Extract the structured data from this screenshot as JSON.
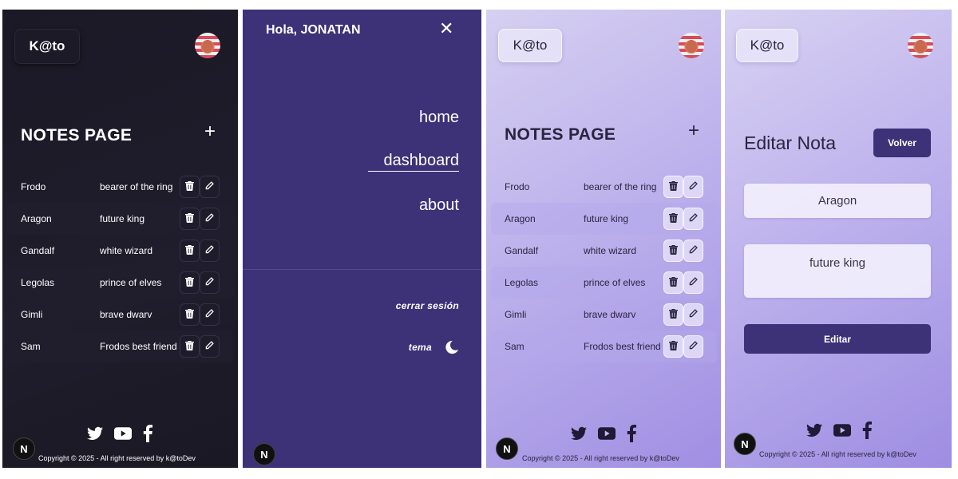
{
  "brand": "K@to",
  "notes_page": {
    "title": "NOTES PAGE",
    "add_symbol": "+",
    "notes": [
      {
        "name": "Frodo",
        "description": "bearer of the ring"
      },
      {
        "name": "Aragon",
        "description": "future king"
      },
      {
        "name": "Gandalf",
        "description": "white wizard"
      },
      {
        "name": "Legolas",
        "description": "prince of elves"
      },
      {
        "name": "Gimli",
        "description": "brave dwarv"
      },
      {
        "name": "Sam",
        "description": "Frodos best friend"
      }
    ]
  },
  "menu": {
    "greeting": "Hola, JONATAN",
    "close_symbol": "✕",
    "links": [
      {
        "label": "home"
      },
      {
        "label": "dashboard",
        "active": true
      },
      {
        "label": "about"
      }
    ],
    "logout": "cerrar sesión",
    "theme_label": "tema"
  },
  "edit_page": {
    "title": "Editar Nota",
    "back_button": "Volver",
    "name_value": "Aragon",
    "description_value": "future king",
    "submit_button": "Editar"
  },
  "footer": {
    "copyright": "Copyright © 2025 - All right reserved by k@toDev",
    "social_icons": [
      "twitter-icon",
      "youtube-icon",
      "facebook-icon"
    ],
    "framework_badge": "N"
  },
  "colors": {
    "dark_bg": "#1b1926",
    "menu_bg": "#3d3278",
    "accent": "#3d3278",
    "light_gradient_start": "#d6d0f1",
    "light_gradient_end": "#a08fe3"
  }
}
